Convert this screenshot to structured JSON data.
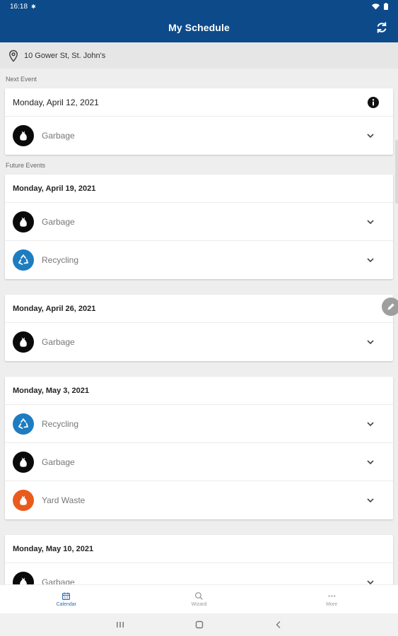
{
  "status": {
    "time": "16:18"
  },
  "header": {
    "title": "My Schedule",
    "refresh_icon": "refresh-icon"
  },
  "address": {
    "text": "10 Gower St, St. John's"
  },
  "colors": {
    "garbage": "#0a0a0a",
    "recycling": "#1e7cc1",
    "yard": "#ea5a1d",
    "brand": "#0d4a8a"
  },
  "next_event": {
    "section_label": "Next Event",
    "date": "Monday, April 12, 2021",
    "items": [
      {
        "label": "Garbage",
        "type": "garbage"
      }
    ]
  },
  "future_events": {
    "section_label": "Future Events",
    "events": [
      {
        "date": "Monday, April 19, 2021",
        "items": [
          {
            "label": "Garbage",
            "type": "garbage"
          },
          {
            "label": "Recycling",
            "type": "recycling"
          }
        ]
      },
      {
        "date": "Monday, April 26, 2021",
        "items": [
          {
            "label": "Garbage",
            "type": "garbage"
          }
        ]
      },
      {
        "date": "Monday, May 3, 2021",
        "items": [
          {
            "label": "Recycling",
            "type": "recycling"
          },
          {
            "label": "Garbage",
            "type": "garbage"
          },
          {
            "label": "Yard Waste",
            "type": "yard"
          }
        ]
      },
      {
        "date": "Monday, May 10, 2021",
        "items": [
          {
            "label": "Garbage",
            "type": "garbage"
          }
        ]
      }
    ]
  },
  "bottom_nav": [
    {
      "label": "Calendar",
      "icon": "calendar-icon",
      "active": true
    },
    {
      "label": "Wizard",
      "icon": "wizard-search-icon",
      "active": false
    },
    {
      "label": "More",
      "icon": "more-icon",
      "active": false
    }
  ]
}
